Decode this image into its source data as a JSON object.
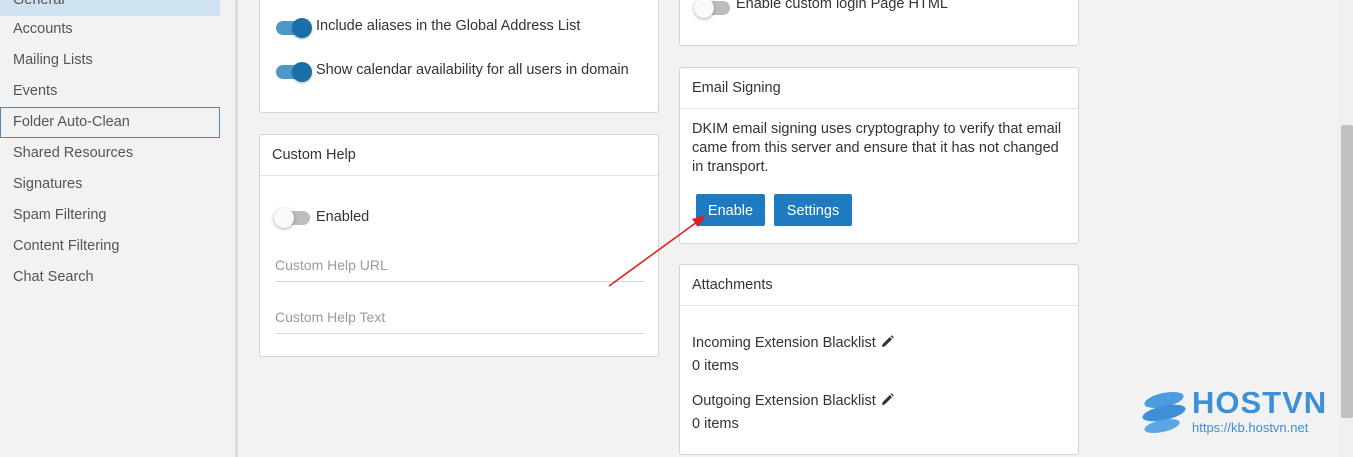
{
  "sidebar": {
    "items": [
      {
        "label": "General"
      },
      {
        "label": "Accounts"
      },
      {
        "label": "Mailing Lists"
      },
      {
        "label": "Events"
      },
      {
        "label": "Folder Auto-Clean"
      },
      {
        "label": "Shared Resources"
      },
      {
        "label": "Signatures"
      },
      {
        "label": "Spam Filtering"
      },
      {
        "label": "Content Filtering"
      },
      {
        "label": "Chat Search"
      }
    ],
    "active_index": 0,
    "focused_index": 4
  },
  "general_card": {
    "toggles": [
      {
        "label": "Include aliases in the Global Address List",
        "on": true
      },
      {
        "label": "Show calendar availability for all users in domain",
        "on": true
      }
    ]
  },
  "custom_help": {
    "title": "Custom Help",
    "enabled_label": "Enabled",
    "enabled": false,
    "url_placeholder": "Custom Help URL",
    "url_value": "",
    "text_placeholder": "Custom Help Text",
    "text_value": ""
  },
  "login_card": {
    "toggle_label": "Enable custom login Page HTML",
    "on": false
  },
  "email_signing": {
    "title": "Email Signing",
    "description": "DKIM email signing uses cryptography to verify that email came from this server and ensure that it has not changed in transport.",
    "enable_label": "Enable",
    "settings_label": "Settings"
  },
  "attachments": {
    "title": "Attachments",
    "incoming_label": "Incoming Extension Blacklist",
    "incoming_value": "0 items",
    "outgoing_label": "Outgoing Extension Blacklist",
    "outgoing_value": "0 items"
  },
  "watermark": {
    "brand": "HOSTVN",
    "url": "https://kb.hostvn.net"
  },
  "colors": {
    "accent": "#1f7bc1",
    "toggle_on": "#1b6fa8",
    "active_item": "#cfe2ef",
    "annotation_arrow": "#e02020"
  },
  "icons": [
    "pencil-icon",
    "hostvn-logo-icon",
    "annotation-arrow"
  ]
}
